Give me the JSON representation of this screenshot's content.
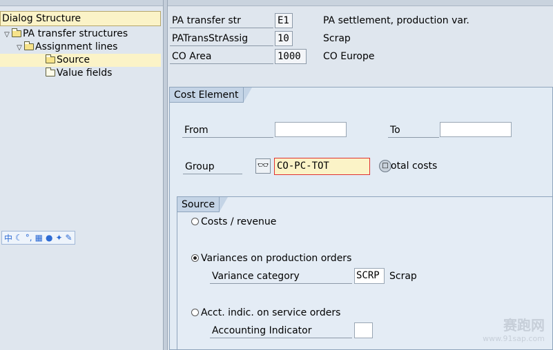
{
  "dialog_structure": {
    "title": "Dialog Structure",
    "items": [
      {
        "label": "PA transfer structures",
        "level": 0,
        "expanded": true
      },
      {
        "label": "Assignment lines",
        "level": 1,
        "expanded": true
      },
      {
        "label": "Source",
        "level": 2,
        "selected": true
      },
      {
        "label": "Value fields",
        "level": 2
      }
    ]
  },
  "ime_toolbar": {
    "chars": [
      "中",
      "☾",
      "°,",
      "▦",
      "●",
      "✦",
      "✎"
    ]
  },
  "header_fields": [
    {
      "label": "PA transfer str",
      "value": "E1",
      "text": "PA settlement, production var."
    },
    {
      "label": "PATransStrAssig",
      "value": "10",
      "text": "Scrap"
    },
    {
      "label": "CO Area",
      "value": "1000",
      "text": "CO Europe"
    }
  ],
  "cost_element": {
    "title": "Cost Element",
    "from_label": "From",
    "from_value": "",
    "to_label": "To",
    "to_value": "",
    "group_label": "Group",
    "group_value": "CO-PC-TOT",
    "group_text": "otal costs"
  },
  "source": {
    "title": "Source",
    "options": [
      {
        "label": "Costs / revenue",
        "selected": false
      },
      {
        "label": "Variances on production orders",
        "selected": true
      },
      {
        "label": "Acct. indic. on service orders",
        "selected": false
      }
    ],
    "variance_category_label": "Variance category",
    "variance_category_value": "SCRP",
    "variance_category_text": "Scrap",
    "accounting_indicator_label": "Accounting Indicator",
    "accounting_indicator_value": ""
  },
  "watermark": {
    "logo_text": "赛跑网",
    "url": "www.91sap.com"
  },
  "colors": {
    "highlight": "#fbf3c7",
    "focus_border": "#e03030",
    "group_header": "#c4d4e6"
  }
}
